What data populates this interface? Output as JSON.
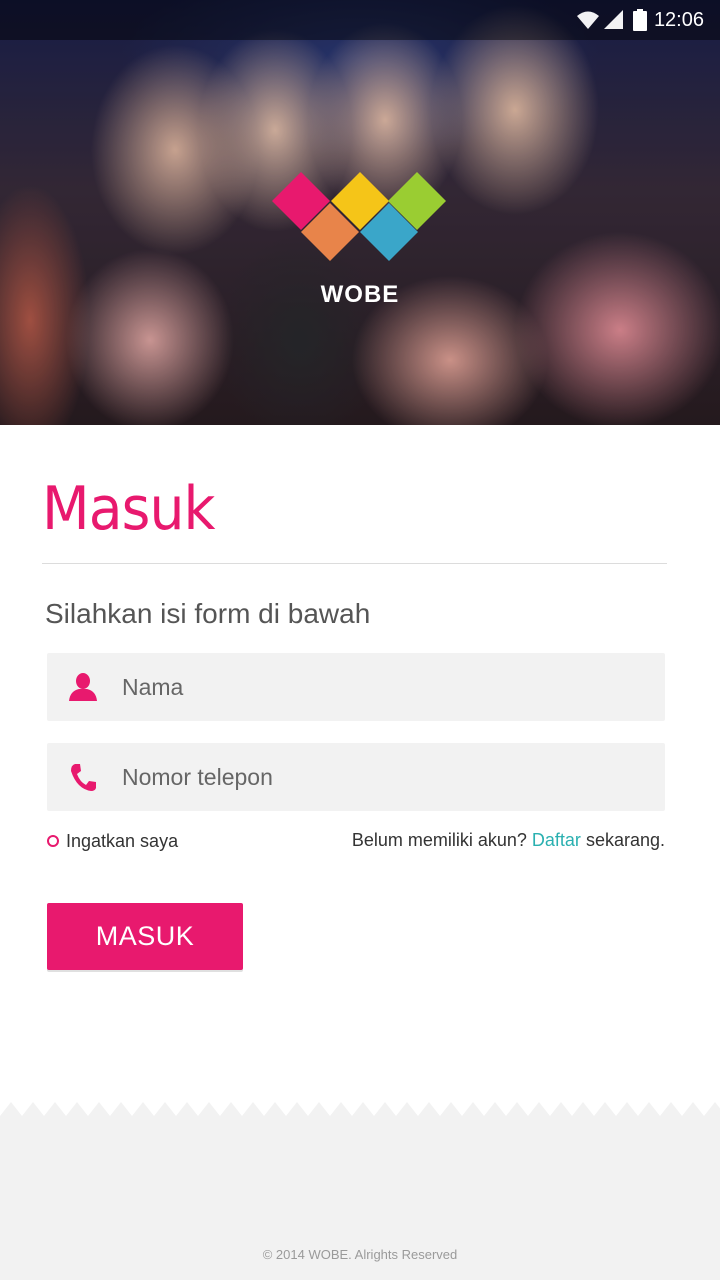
{
  "status_bar": {
    "time": "12:06"
  },
  "brand": {
    "name": "WOBE",
    "tile_colors": [
      "#e8196e",
      "#f5c518",
      "#9acd32",
      "#e8844a",
      "#3aa6c9"
    ]
  },
  "login": {
    "title": "Masuk",
    "subtitle": "Silahkan isi form di bawah",
    "name_placeholder": "Nama",
    "phone_placeholder": "Nomor telepon",
    "remember_label": "Ingatkan saya",
    "signup_prefix": "Belum memiliki akun?",
    "signup_link": "Daftar",
    "signup_suffix": "sekarang.",
    "submit_label": "MASUK"
  },
  "footer": {
    "copyright": "© 2014 WOBE. Alrights Reserved"
  },
  "colors": {
    "accent": "#e8196e",
    "link": "#2ab0b0",
    "footer_bg": "#f2f2f2"
  }
}
